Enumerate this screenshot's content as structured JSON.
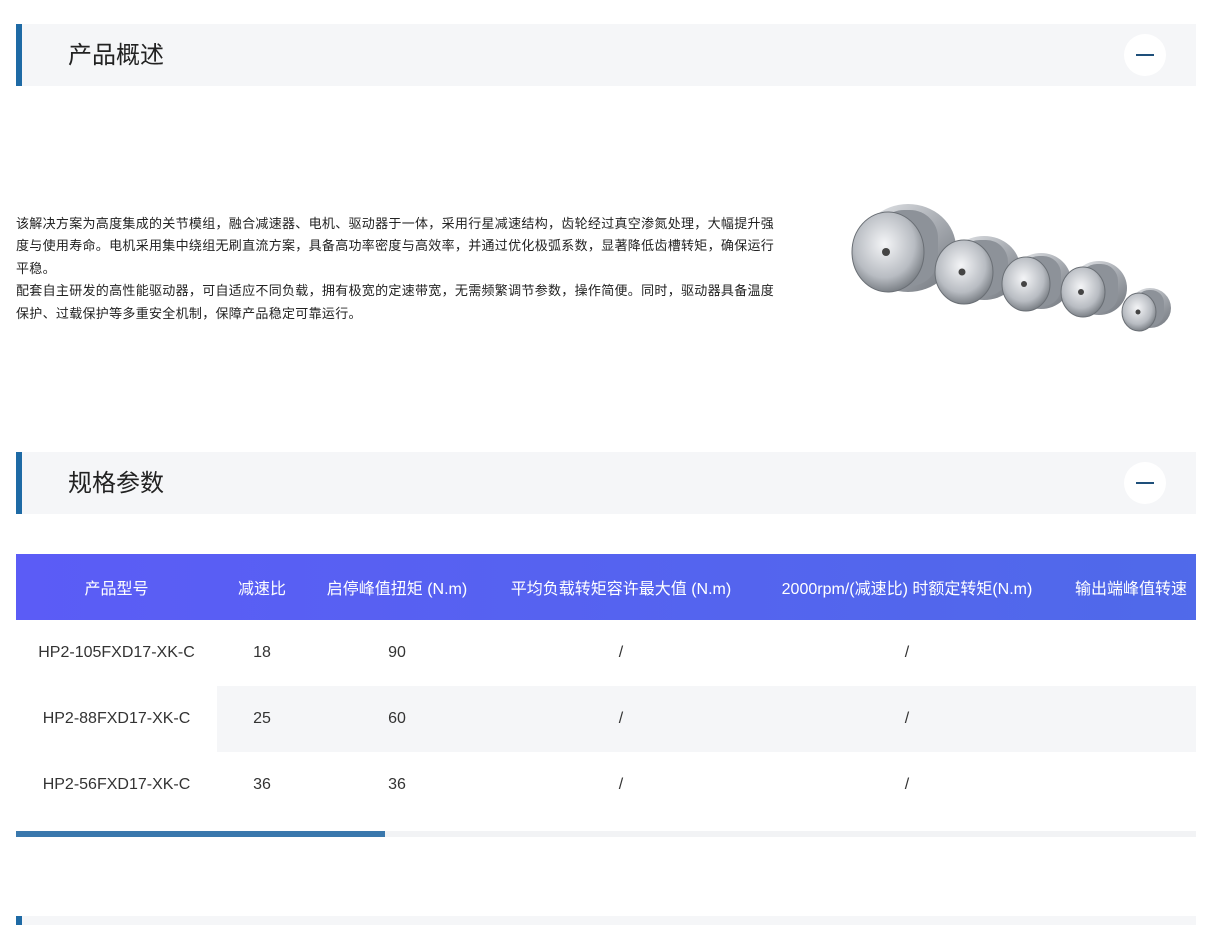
{
  "sections": {
    "overview": {
      "title": "产品概述"
    },
    "specs": {
      "title": "规格参数"
    }
  },
  "overview": {
    "paragraphs": [
      "该解决方案为高度集成的关节模组，融合减速器、电机、驱动器于一体，采用行星减速结构，齿轮经过真空渗氮处理，大幅提升强度与使用寿命。电机采用集中绕组无刷直流方案，具备高功率密度与高效率，并通过优化极弧系数，显著降低齿槽转矩，确保运行平稳。",
      "配套自主研发的高性能驱动器，可自适应不同负载，拥有极宽的定速带宽，无需频繁调节参数，操作简便。同时，驱动器具备温度保护、过载保护等多重安全机制，保障产品稳定可靠运行。"
    ]
  },
  "table": {
    "headers": [
      "产品型号",
      "减速比",
      "启停峰值扭矩 (N.m)",
      "平均负载转矩容许最大值 (N.m)",
      "2000rpm/(减速比) 时额定转矩(N.m)",
      "输出端峰值转速"
    ],
    "rows": [
      [
        "HP2-105FXD17-XK-C",
        "18",
        "90",
        "/",
        "/",
        "/"
      ],
      [
        "HP2-88FXD17-XK-C",
        "25",
        "60",
        "/",
        "/",
        "/"
      ],
      [
        "HP2-56FXD17-XK-C",
        "36",
        "36",
        "/",
        "/",
        "/"
      ]
    ]
  },
  "icons": {
    "collapse": "minus-icon"
  },
  "colors": {
    "accent": "#1e6aa5",
    "header_gradient_start": "#5b5cf6",
    "header_gradient_end": "#4f6ae9",
    "scroll_thumb": "#3a78ad"
  }
}
